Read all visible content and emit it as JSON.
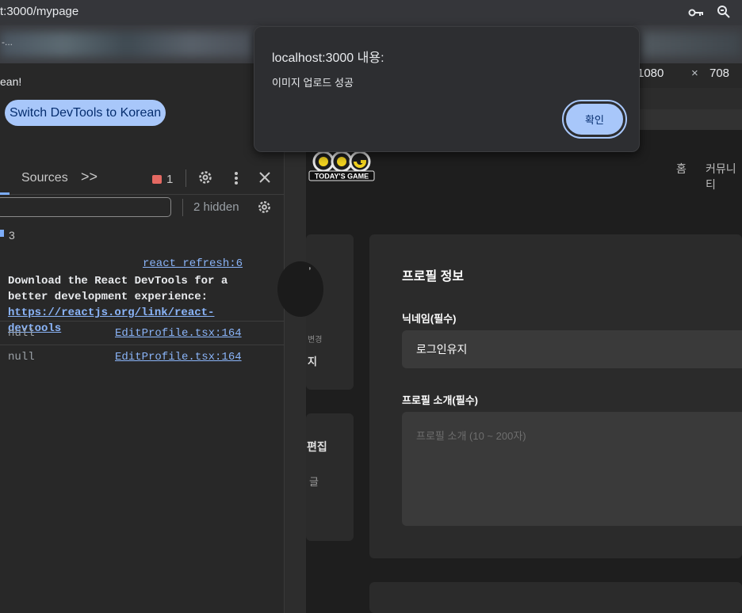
{
  "browser": {
    "url": "t:3000/mypage",
    "bar2_text": "-...",
    "icons": [
      "key-icon",
      "zoom-icon"
    ]
  },
  "devtools": {
    "lang_text": "ean!",
    "lang_button": "Switch DevTools to Korean",
    "tabs": {
      "sources": "Sources",
      "more": ">>"
    },
    "error_count": "1",
    "hidden_label": "2 hidden",
    "message_count": "3",
    "filter_value": "",
    "log": {
      "source_react": "react_refresh:6",
      "react_msg_plain": "Download the React DevTools for a better development experience: ",
      "react_link": "https://reactjs.org/link/react-devtools",
      "lines": [
        {
          "value": "null",
          "source": "EditProfile.tsx:164"
        },
        {
          "value": "null",
          "source": "EditProfile.tsx:164"
        }
      ]
    }
  },
  "device": {
    "width": "1080",
    "x": "×",
    "height": "708"
  },
  "site": {
    "logo_text": "TODAY'S GAME",
    "nav": {
      "home": "홈",
      "community": "커뮤니티"
    },
    "left": {
      "change": "변경",
      "nickname": "지",
      "edit": "편집",
      "post": "글",
      "mark": ","
    },
    "profile_title": "프로필 정보",
    "nickname_label": "닉네임(필수)",
    "nickname_value": "로그인유지",
    "intro_label": "프로필 소개(필수)",
    "intro_placeholder": "프로필 소개 (10 ~ 200자)"
  },
  "dialog": {
    "title": "localhost:3000 내용:",
    "message": "이미지 업로드 성공",
    "ok": "확인"
  },
  "colors": {
    "accent": "#a8c7fa",
    "link": "#8ab4f8",
    "error": "#e46962"
  }
}
